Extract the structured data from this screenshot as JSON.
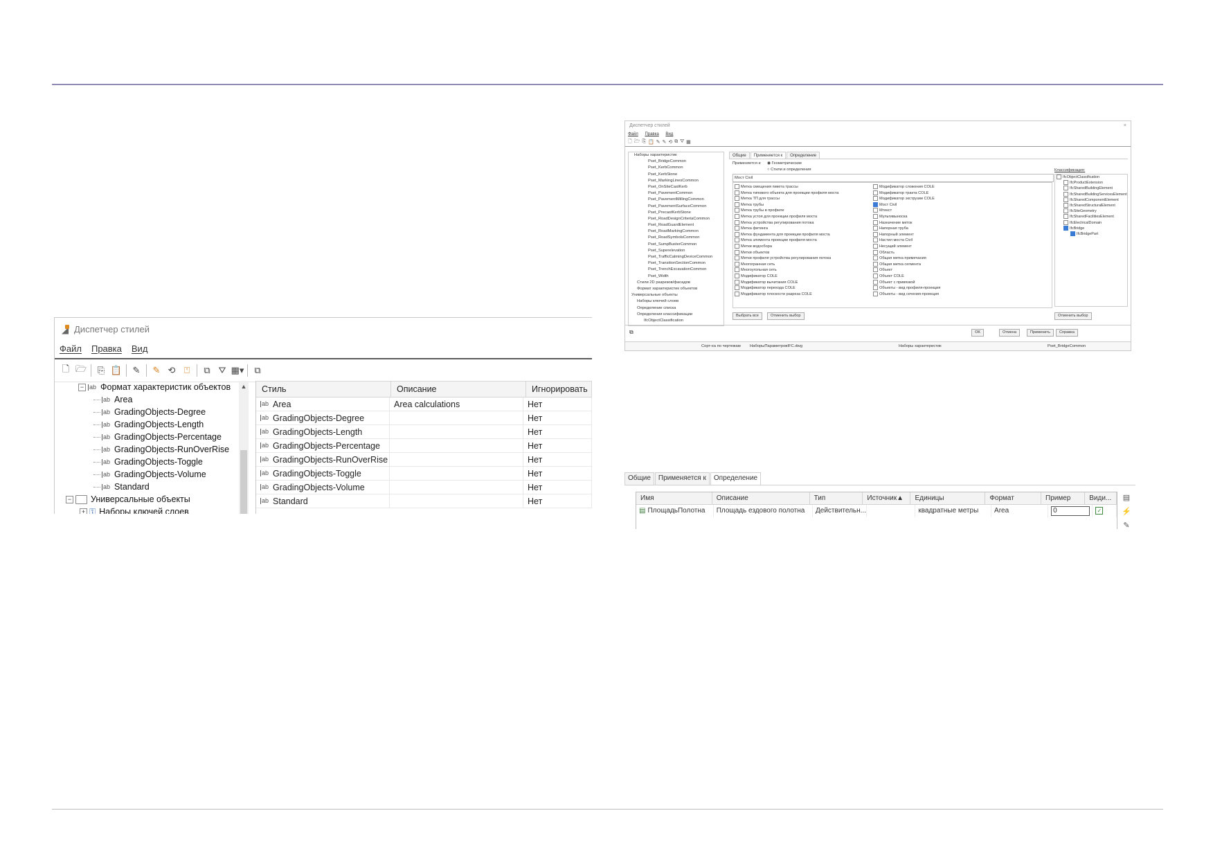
{
  "style_manager": {
    "title": "Диспетчер стилей",
    "menu": [
      "Файл",
      "Правка",
      "Вид"
    ],
    "tree": {
      "parent_label": "Формат характеристик объектов",
      "children": [
        "Area",
        "GradingObjects-Degree",
        "GradingObjects-Length",
        "GradingObjects-Percentage",
        "GradingObjects-RunOverRise",
        "GradingObjects-Toggle",
        "GradingObjects-Volume",
        "Standard"
      ],
      "universal_label": "Универсальные объекты",
      "layer_keys_label": "Наборы ключей слоев"
    },
    "grid": {
      "headers": [
        "Стиль",
        "Описание",
        "Игнорировать"
      ],
      "rows": [
        {
          "style": "Area",
          "description": "Area calculations",
          "ignore": "Нет"
        },
        {
          "style": "GradingObjects-Degree",
          "description": "",
          "ignore": "Нет"
        },
        {
          "style": "GradingObjects-Length",
          "description": "",
          "ignore": "Нет"
        },
        {
          "style": "GradingObjects-Percentage",
          "description": "",
          "ignore": "Нет"
        },
        {
          "style": "GradingObjects-RunOverRise",
          "description": "",
          "ignore": "Нет"
        },
        {
          "style": "GradingObjects-Toggle",
          "description": "",
          "ignore": "Нет"
        },
        {
          "style": "GradingObjects-Volume",
          "description": "",
          "ignore": "Нет"
        },
        {
          "style": "Standard",
          "description": "",
          "ignore": "Нет"
        }
      ]
    }
  },
  "small_dialog": {
    "title": "Диспетчер стилей",
    "menu": [
      "Файл",
      "Правка",
      "Вид"
    ],
    "tree": [
      "Наборы характеристик",
      "Pset_BridgeCommon",
      "Pset_KerbCommon",
      "Pset_KerbStone",
      "Pset_MarkingLinesCommon",
      "Pset_OnSiteCastKerb",
      "Pset_PavementCommon",
      "Pset_PavementMillingCommon",
      "Pset_PavementSurfaceCommon",
      "Pset_PrecastKerbStone",
      "Pset_RoadDesignCriteriaCommon",
      "Pset_RoadGuardElement",
      "Pset_RoadMarkingCommon",
      "Pset_RoadSymbolsCommon",
      "Pset_SumpBusterCommon",
      "Pset_Superelevation",
      "Pset_TrafficCalmingDeviceCommon",
      "Pset_TransitionSectionCommon",
      "Pset_TrenchExcavationCommon",
      "Pset_Width",
      "Стили 2D разрезов/фасадов",
      "Формат характеристик объектов",
      "Универсальные объекты",
      "Наборы ключей слоев",
      "Определение списка",
      "Определения классификации",
      "IfcObjectClassification"
    ],
    "tabs": [
      "Общие",
      "Применяется к",
      "Определение"
    ],
    "applies_to": "Применяется к:",
    "radio1": "Геометрические",
    "radio2": "Стили и определения",
    "filter_value": "Мост Civil",
    "list_left": [
      "Метка смещения пикета трассы",
      "Метка типового объекта для проекции профиля моста",
      "Метка ТП для трассы",
      "Метка трубы",
      "Метка трубы в профиле",
      "Метка устоя для проекции профиля моста",
      "Метка устройства регулирования потока",
      "Метка фитинга",
      "Метка фундамента для проекции профиля моста",
      "Метка элемента проекции профиля моста",
      "Метки водосбора",
      "Метки объектов",
      "Метки профиля устройства регулирования потока",
      "Многогранная сеть",
      "Многоугольная сеть",
      "Модификатор COLE",
      "Модификатор вычитания COLE",
      "Модификатор перехода COLE",
      "Модификатор плоскости разреза COLE"
    ],
    "list_right": [
      "Модификатор сложения COLE",
      "Модификатор тракта COLE",
      "Модификатор экструзии COLE",
      "Мост Civil",
      "Мтекст",
      "Мультивыноска",
      "Назначение меток",
      "Напорная труба",
      "Напорный элемент",
      "Настил моста Civil",
      "Несущий элемент",
      "Область",
      "Общая метка примечания",
      "Общая метка сегмента",
      "Объект",
      "Объект COLE",
      "Объект с привязкой",
      "Объекты - вид профиля-проекция",
      "Объекты - вид сечения-проекция"
    ],
    "classification_label": "Классификация:",
    "classification": [
      "IfcObjectClassification",
      "IfcProductExtension",
      "IfcSharedBuildingElement",
      "IfcSharedBuildingServicesElement",
      "IfcSharedComponentElement",
      "IfcSharedStructuralElement",
      "IfcSiteGeometry",
      "IfcSharedFacilitiesElement",
      "IfcElectricalDomain",
      "IfcBridge",
      "IfcBridgePart"
    ],
    "btn_select_all": "Выбрать все",
    "btn_clear": "Отменить выбор",
    "btn_clear2": "Отменить выбор",
    "btn_ok": "OK",
    "btn_cancel": "Отмена",
    "btn_apply": "Применить",
    "btn_help": "Справка",
    "status_sort": "Сорт-ка по чертежам",
    "status_file": "НаборыПараметровIFC.dwg",
    "status_set": "Наборы характеристик",
    "status_item": "Pset_BridgeCommon"
  },
  "definition_dialog": {
    "tabs": [
      "Общие",
      "Применяется к",
      "Определение"
    ],
    "headers": [
      "Имя",
      "Описание",
      "Тип",
      "Источник▲",
      "Единицы",
      "Формат",
      "Пример",
      "Види..."
    ],
    "row": {
      "name": "ПлощадьПолотна",
      "description": "Площадь ездового полотна",
      "type": "Действительн...",
      "source": "",
      "units": "квадратные метры",
      "format": "Area",
      "example": "0"
    }
  }
}
